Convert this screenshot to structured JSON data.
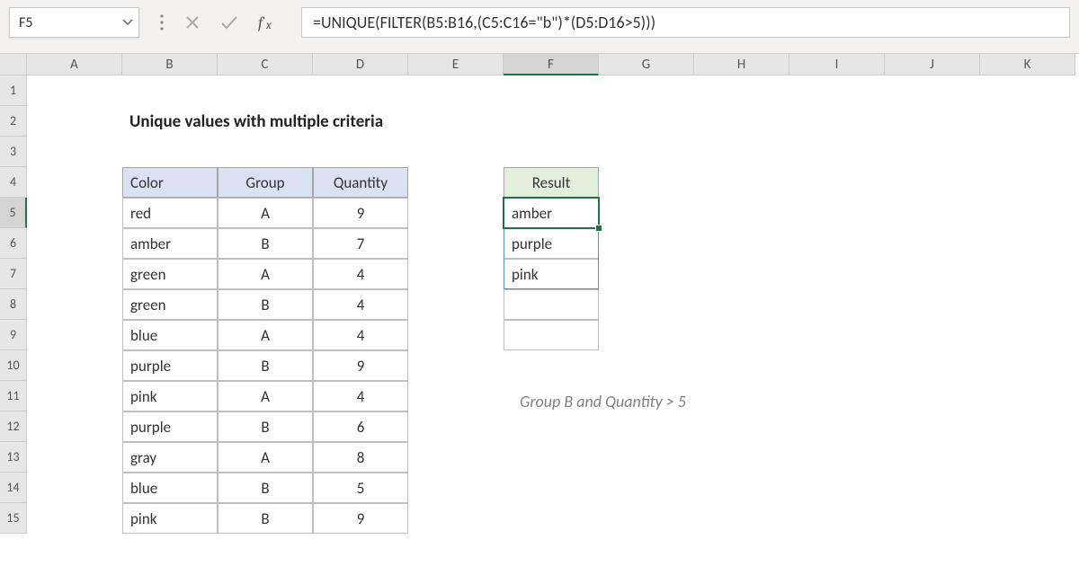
{
  "namebox": "F5",
  "formula": "=UNIQUE(FILTER(B5:B16,(C5:C16=\"b\")*(D5:D16>5)))",
  "columns": [
    "A",
    "B",
    "C",
    "D",
    "E",
    "F",
    "G",
    "H",
    "I",
    "J",
    "K"
  ],
  "selectedCol": "F",
  "rows": [
    "1",
    "2",
    "3",
    "4",
    "5",
    "6",
    "7",
    "8",
    "9",
    "10",
    "11",
    "12",
    "13",
    "14",
    "15"
  ],
  "selectedRow": "5",
  "title": "Unique values with multiple criteria",
  "headers": {
    "color": "Color",
    "group": "Group",
    "quantity": "Quantity",
    "result": "Result"
  },
  "data": [
    {
      "color": "red",
      "group": "A",
      "qty": "9"
    },
    {
      "color": "amber",
      "group": "B",
      "qty": "7"
    },
    {
      "color": "green",
      "group": "A",
      "qty": "4"
    },
    {
      "color": "green",
      "group": "B",
      "qty": "4"
    },
    {
      "color": "blue",
      "group": "A",
      "qty": "4"
    },
    {
      "color": "purple",
      "group": "B",
      "qty": "9"
    },
    {
      "color": "pink",
      "group": "A",
      "qty": "4"
    },
    {
      "color": "purple",
      "group": "B",
      "qty": "6"
    },
    {
      "color": "gray",
      "group": "A",
      "qty": "8"
    },
    {
      "color": "blue",
      "group": "B",
      "qty": "5"
    },
    {
      "color": "pink",
      "group": "B",
      "qty": "9"
    }
  ],
  "results": [
    "amber",
    "purple",
    "pink",
    "",
    ""
  ],
  "caption": "Group B and Quantity > 5"
}
